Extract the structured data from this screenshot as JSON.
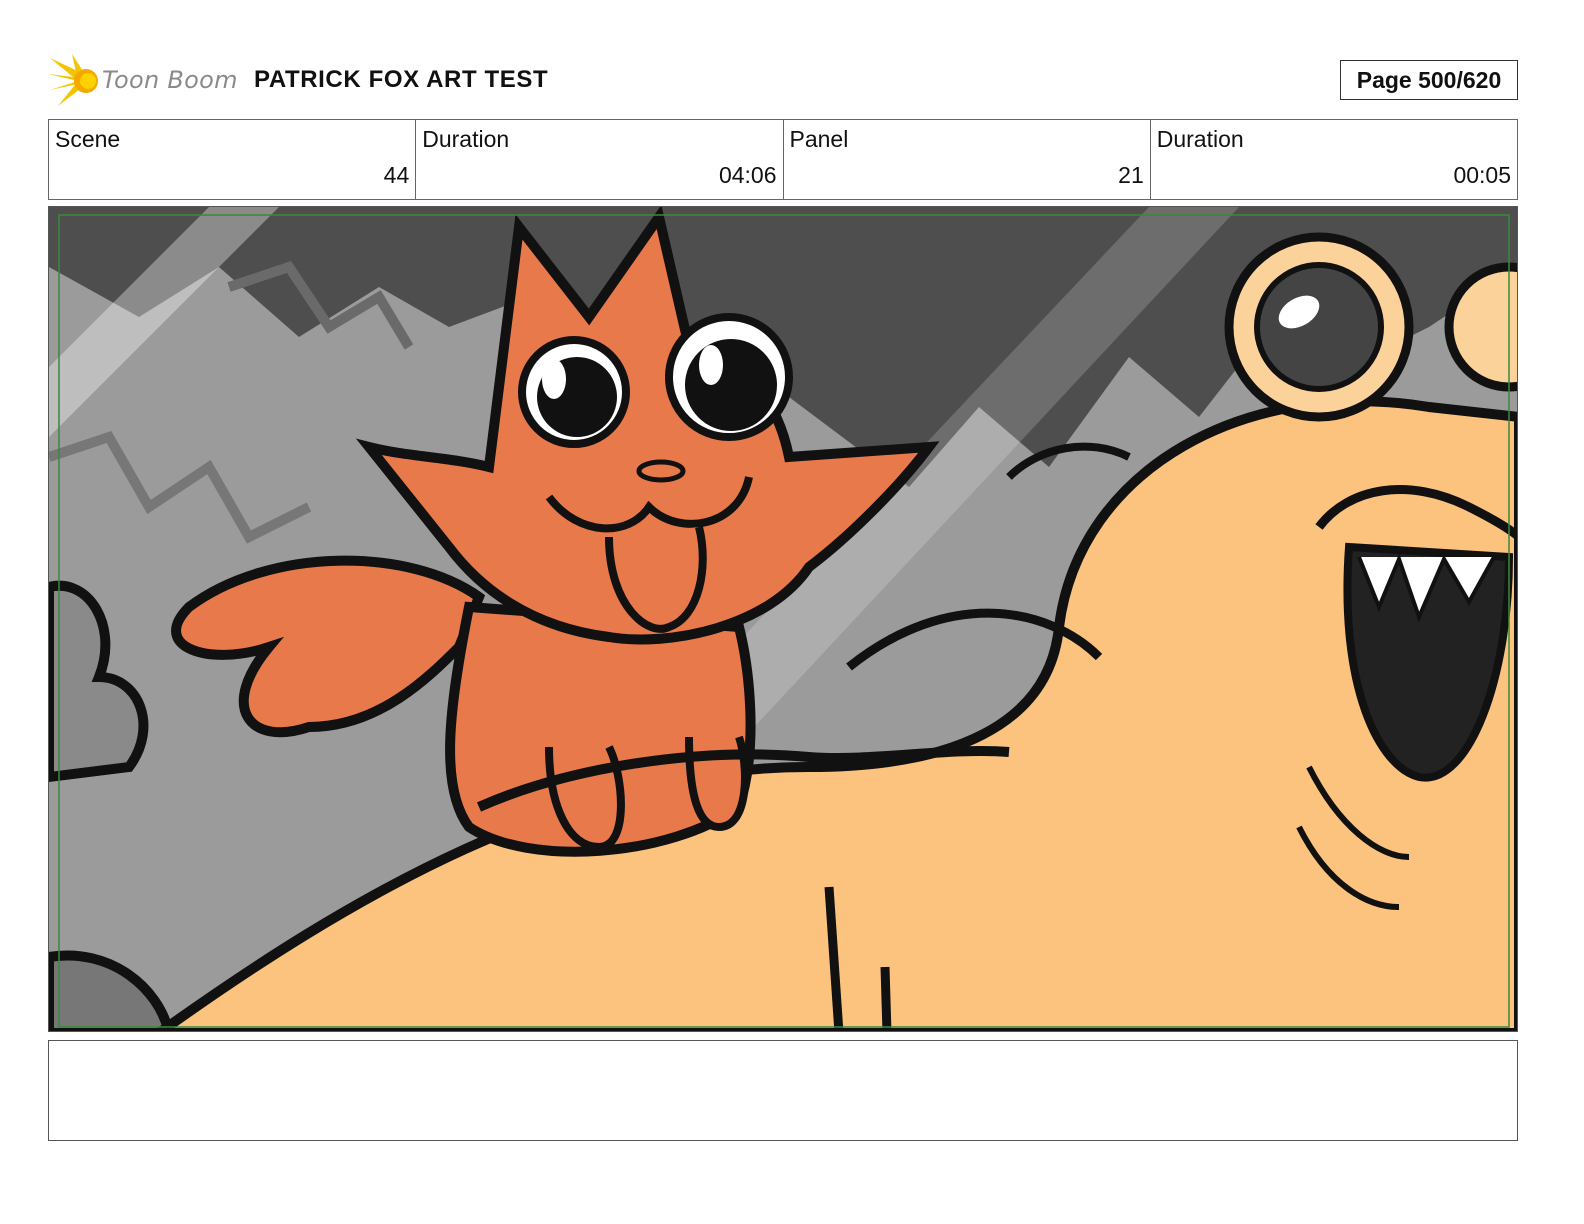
{
  "header": {
    "logo_text": "Toon Boom",
    "project_title": "PATRICK FOX ART TEST",
    "page_label": "Page 500/620"
  },
  "info": {
    "scene_label": "Scene",
    "scene_value": "44",
    "scene_duration_label": "Duration",
    "scene_duration_value": "04:06",
    "panel_label": "Panel",
    "panel_value": "21",
    "panel_duration_label": "Duration",
    "panel_duration_value": "00:05"
  },
  "panel": {
    "image": "cartoon-fox-and-large-creature-drawing",
    "colors": {
      "fox": "#e8794a",
      "creature": "#fcc37f",
      "background": "#9a9a9a",
      "dark_bg": "#4a4a4a",
      "safe_frame": "#3a8a3a"
    }
  },
  "notes": {
    "text": ""
  }
}
